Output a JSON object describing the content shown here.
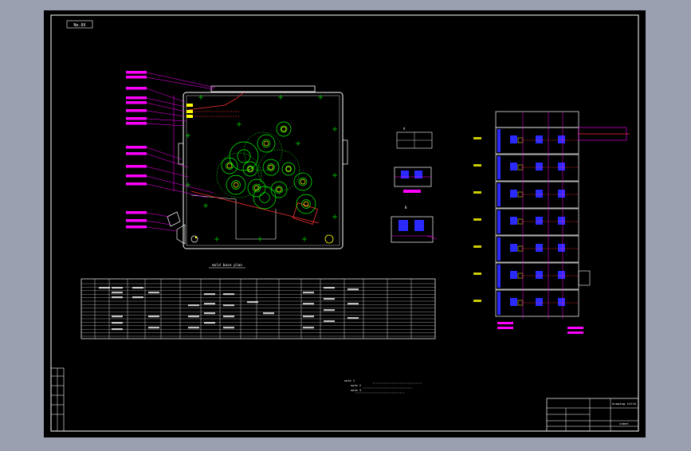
{
  "sheet_tag": "No.0X",
  "drawing": {
    "plan_caption": "mold base plan",
    "note_lines": [
      "note 1",
      "note 2",
      "note 3"
    ],
    "title_block": {
      "top_right": "drawing title",
      "sheet_label": "sheet"
    }
  },
  "colors": {
    "background": "#9aa0b0",
    "sheet": "#000000",
    "border": "#ffffff",
    "magenta": "#ff00ff",
    "green": "#00ff00",
    "red": "#ff3030",
    "yellow": "#ffff00",
    "blue": "#2a2aff",
    "cyan": "#00ffff"
  }
}
